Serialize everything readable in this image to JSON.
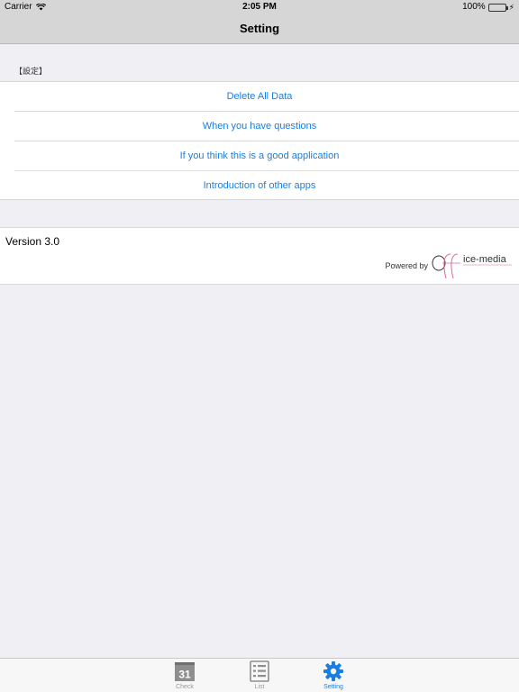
{
  "status_bar": {
    "carrier": "Carrier",
    "time": "2:05 PM",
    "battery_percent": "100%",
    "battery_level": 1.0
  },
  "nav": {
    "title": "Setting"
  },
  "settings": {
    "section_header": "【設定】",
    "items": [
      {
        "label": "Delete All Data"
      },
      {
        "label": "When you have questions"
      },
      {
        "label": "If you think this is a good application"
      },
      {
        "label": "Introduction of other apps"
      }
    ]
  },
  "info": {
    "version": "Version 3.0",
    "powered_by": "Powered by",
    "brand_name": "Office-media"
  },
  "tab_bar": {
    "tabs": [
      {
        "label": "Check",
        "icon": "calendar-31-icon",
        "icon_text": "31",
        "active": false
      },
      {
        "label": "List",
        "icon": "list-icon",
        "active": false
      },
      {
        "label": "Setting",
        "icon": "gear-icon",
        "active": true
      }
    ]
  },
  "colors": {
    "accent": "#1a7fe0",
    "bar_background": "#d6d6d6",
    "page_background": "#efeff4",
    "battery": "#4cd964",
    "brand_pink": "#e0679a"
  }
}
